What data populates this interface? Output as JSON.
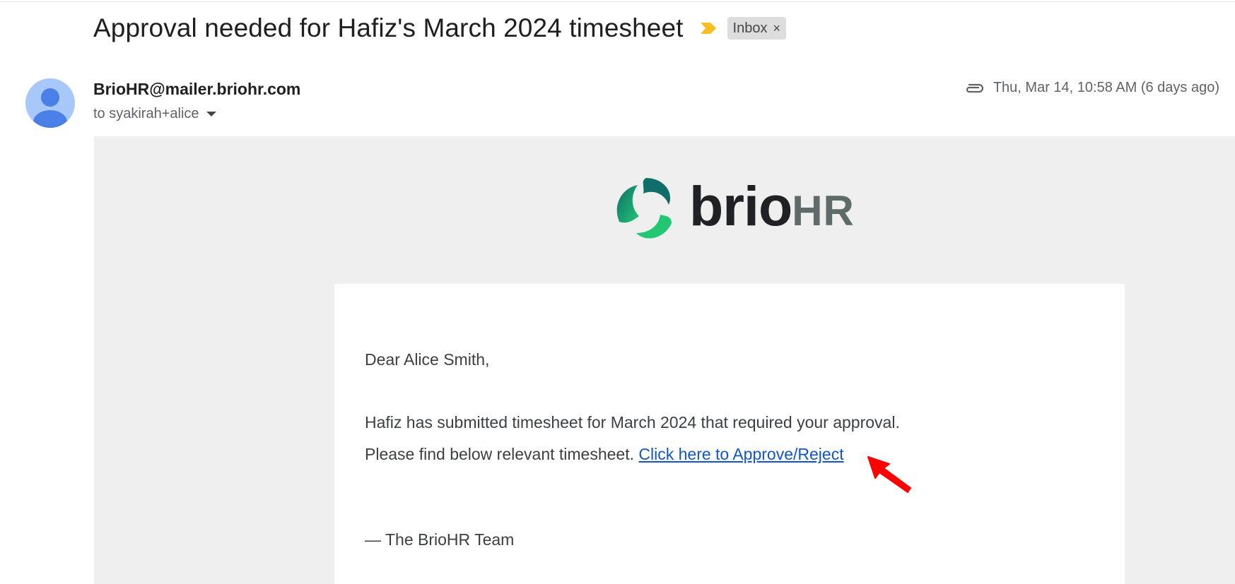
{
  "email": {
    "subject": "Approval needed for Hafiz's March 2024 timesheet",
    "label": "Inbox",
    "label_remove": "×",
    "sender": "BrioHR@mailer.briohr.com",
    "recipient": "to syakirah+alice",
    "datetime": "Thu, Mar 14, 10:58 AM (6 days ago)"
  },
  "brand": {
    "name_primary": "brio",
    "name_secondary": "HR"
  },
  "body": {
    "greeting": "Dear Alice Smith,",
    "line1": "Hafiz has submitted timesheet for March 2024 that required your approval.",
    "line2_prefix": "Please find below relevant timesheet. ",
    "link_text": "Click here to Approve/Reject",
    "signoff": "— The BrioHR Team"
  },
  "colors": {
    "link": "#1155cc",
    "importance_marker": "#f6bf26",
    "annotation_arrow": "#ff0000",
    "brand_green": "#1fbf6b",
    "brand_teal": "#0f6e6a"
  },
  "icons": {
    "importance": "importance-marker-icon",
    "attachment": "paperclip-icon",
    "avatar": "default-avatar-icon",
    "recipient_dropdown": "caret-down-icon",
    "annotation": "red-arrow-icon"
  }
}
